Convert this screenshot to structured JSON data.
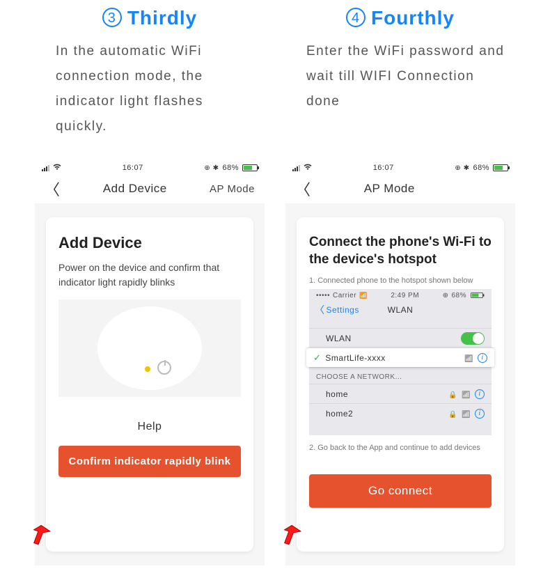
{
  "steps": {
    "three": {
      "num": "3",
      "label": "Thirdly",
      "desc": "In the automatic WiFi connection mode, the indicator light flashes quickly."
    },
    "four": {
      "num": "4",
      "label": "Fourthly",
      "desc": "Enter the WiFi password and wait till WIFI Connection done"
    }
  },
  "phone_status": {
    "time": "16:07",
    "battery_pct": "68%"
  },
  "screen3": {
    "nav_title": "Add Device",
    "nav_right": "AP Mode",
    "card_title": "Add Device",
    "card_sub": "Power on the device and confirm that indicator light rapidly blinks",
    "help": "Help",
    "cta": "Confirm indicator rapidly blink"
  },
  "screen4": {
    "nav_title": "AP Mode",
    "card_title": "Connect the phone's Wi-Fi to the device's hotspot",
    "note1": "1. Connected phone to the hotspot shown below",
    "note2": "2. Go back to the App and continue to add devices",
    "cta": "Go connect",
    "wlan": {
      "carrier": "Carrier",
      "time": "2:49 PM",
      "battery": "68%",
      "settings": "Settings",
      "title": "WLAN",
      "toggle_label": "WLAN",
      "selected": "SmartLife-xxxx",
      "section": "CHOOSE A NETWORK...",
      "net1": "home",
      "net2": "home2"
    }
  }
}
